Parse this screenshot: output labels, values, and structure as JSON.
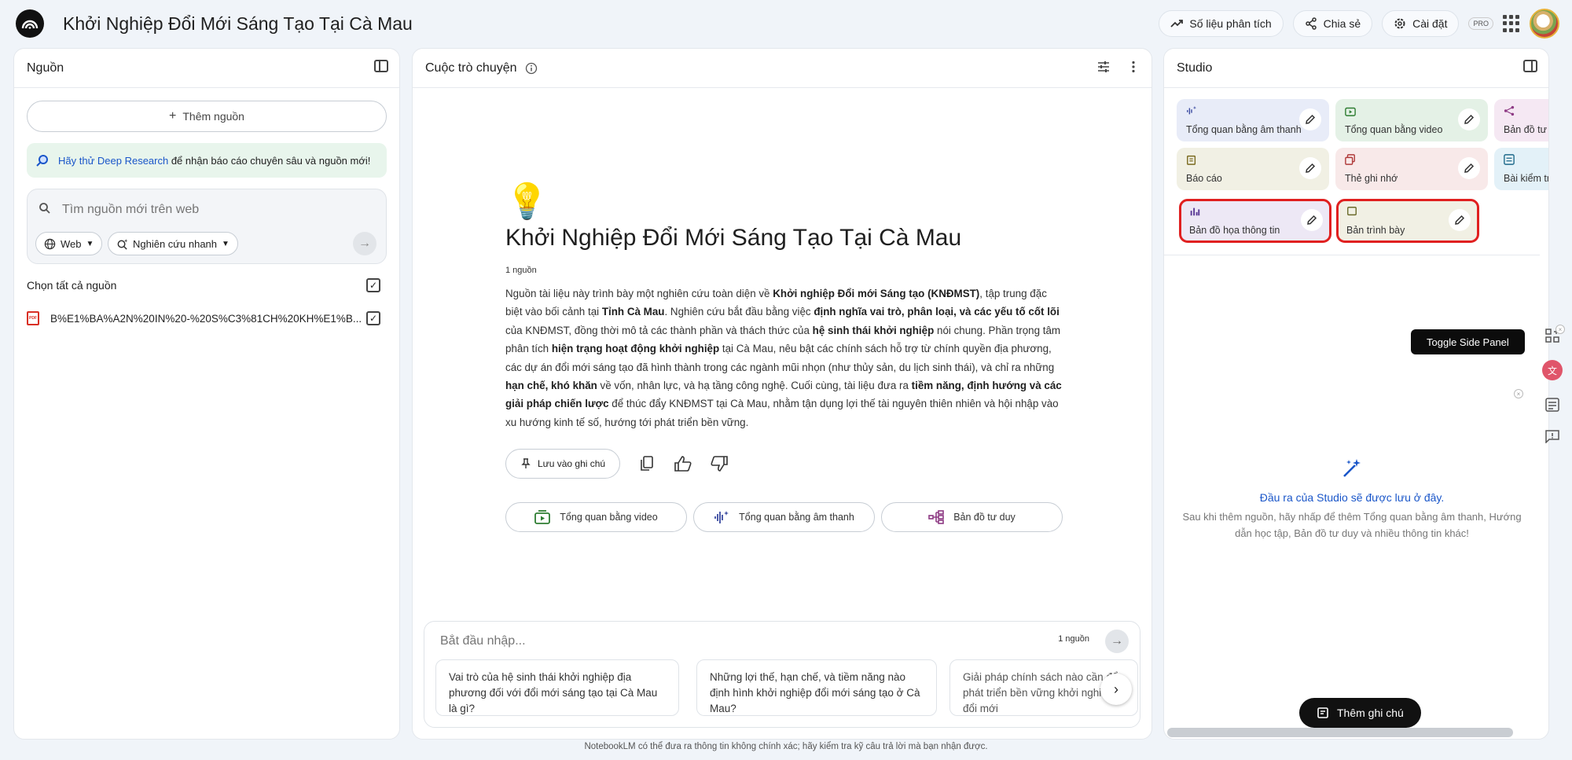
{
  "topbar": {
    "title": "Khởi Nghiệp Đổi Mới Sáng Tạo Tại Cà Mau",
    "analytics_label": "Số liệu phân tích",
    "share_label": "Chia sẻ",
    "settings_label": "Cài đặt",
    "pro_badge": "PRO"
  },
  "sources": {
    "title": "Nguồn",
    "add_label": "Thêm nguồn",
    "deep_research": {
      "link": "Hãy thử Deep Research",
      "text": " để nhận báo cáo chuyên sâu và nguồn mới!"
    },
    "search_placeholder": "Tìm nguồn mới trên web",
    "chip_web": "Web",
    "chip_research": "Nghiên cứu nhanh",
    "select_all": "Chọn tất cả nguồn",
    "files": [
      {
        "name": "B%E1%BA%A2N%20IN%20-%20S%C3%81CH%20KH%E1%B..."
      }
    ]
  },
  "chat": {
    "title": "Cuộc trò chuyện",
    "notebook_title": "Khởi Nghiệp Đổi Mới Sáng Tạo Tại Cà Mau",
    "source_count": "1 nguồn",
    "summary": [
      {
        "t": "Nguồn tài liệu này trình bày một nghiên cứu toàn diện về ",
        "b": false
      },
      {
        "t": "Khởi nghiệp Đổi mới Sáng tạo (KNĐMST)",
        "b": true
      },
      {
        "t": ", tập trung đặc biệt vào bối cảnh tại ",
        "b": false
      },
      {
        "t": "Tỉnh Cà Mau",
        "b": true
      },
      {
        "t": ". Nghiên cứu bắt đầu bằng việc ",
        "b": false
      },
      {
        "t": "định nghĩa vai trò, phân loại, và các yếu tố cốt lõi",
        "b": true
      },
      {
        "t": " của KNĐMST, đồng thời mô tả các thành phần và thách thức của ",
        "b": false
      },
      {
        "t": "hệ sinh thái khởi nghiệp",
        "b": true
      },
      {
        "t": " nói chung. Phần trọng tâm phân tích ",
        "b": false
      },
      {
        "t": "hiện trạng hoạt động khởi nghiệp",
        "b": true
      },
      {
        "t": " tại Cà Mau, nêu bật các chính sách hỗ trợ từ chính quyền địa phương, các dự án đổi mới sáng tạo đã hình thành trong các ngành mũi nhọn (như thủy sản, du lịch sinh thái), và chỉ ra những ",
        "b": false
      },
      {
        "t": "hạn chế, khó khăn",
        "b": true
      },
      {
        "t": " về vốn, nhân lực, và hạ tầng công nghệ. Cuối cùng, tài liệu đưa ra ",
        "b": false
      },
      {
        "t": "tiềm năng, định hướng và các giải pháp chiến lược",
        "b": true
      },
      {
        "t": " để thúc đẩy KNĐMST tại Cà Mau, nhằm tận dụng lợi thế tài nguyên thiên nhiên và hội nhập vào xu hướng kinh tế số, hướng tới phát triển bền vững.",
        "b": false
      }
    ],
    "save_note": "Lưu vào ghi chú",
    "quick_actions": [
      "Tổng quan bằng video",
      "Tổng quan bằng âm thanh",
      "Bản đồ tư duy"
    ],
    "composer_placeholder": "Bắt đầu nhập...",
    "composer_count": "1 nguồn",
    "suggestions": [
      "Vai trò của hệ sinh thái khởi nghiệp địa phương đối với đổi mới sáng tạo tại Cà Mau là gì?",
      "Những lợi thế, hạn chế, và tiềm năng nào định hình khởi nghiệp đổi mới sáng tạo ở Cà Mau?",
      "Giải pháp chính sách nào cần để phát triển bền vững khởi nghiệp đổi mới"
    ]
  },
  "studio": {
    "title": "Studio",
    "tiles": [
      {
        "label": "Tổng quan bằng âm thanh",
        "bg": "#e8ecf8",
        "icon": "audio-sparkle-icon",
        "accent": "#3a4aa0"
      },
      {
        "label": "Tổng quan bằng video",
        "bg": "#e4f1e6",
        "icon": "video-icon",
        "accent": "#2e7d32"
      },
      {
        "label": "Bản đồ tư duy",
        "bg": "#f5e8f3",
        "icon": "mindmap-icon",
        "accent": "#8e3a84"
      },
      {
        "label": "Báo cáo",
        "bg": "#f1f0e4",
        "icon": "report-icon",
        "accent": "#7a6a1f"
      },
      {
        "label": "Thẻ ghi nhớ",
        "bg": "#f8e9e9",
        "icon": "flashcard-icon",
        "accent": "#b03a3a"
      },
      {
        "label": "Bài kiểm tra",
        "bg": "#e3f1f8",
        "icon": "quiz-icon",
        "accent": "#1f6a8a"
      },
      {
        "label": "Bản đồ họa thông tin",
        "bg": "#ede8f5",
        "icon": "infographic-icon",
        "accent": "#5a3a96"
      },
      {
        "label": "Bản trình bày",
        "bg": "#f1f0e4",
        "icon": "slides-icon",
        "accent": "#6a6a2a"
      }
    ],
    "empty_title": "Đầu ra của Studio sẽ được lưu ở đây.",
    "empty_text": "Sau khi thêm nguồn, hãy nhấp để thêm Tổng quan bằng âm thanh, Hướng dẫn học tập, Bản đồ tư duy và nhiều thông tin khác!",
    "add_note": "Thêm ghi chú"
  },
  "tooltip": "Toggle Side Panel",
  "footer": "NotebookLM có thể đưa ra thông tin không chính xác; hãy kiểm tra kỹ câu trả lời mà bạn nhận được."
}
